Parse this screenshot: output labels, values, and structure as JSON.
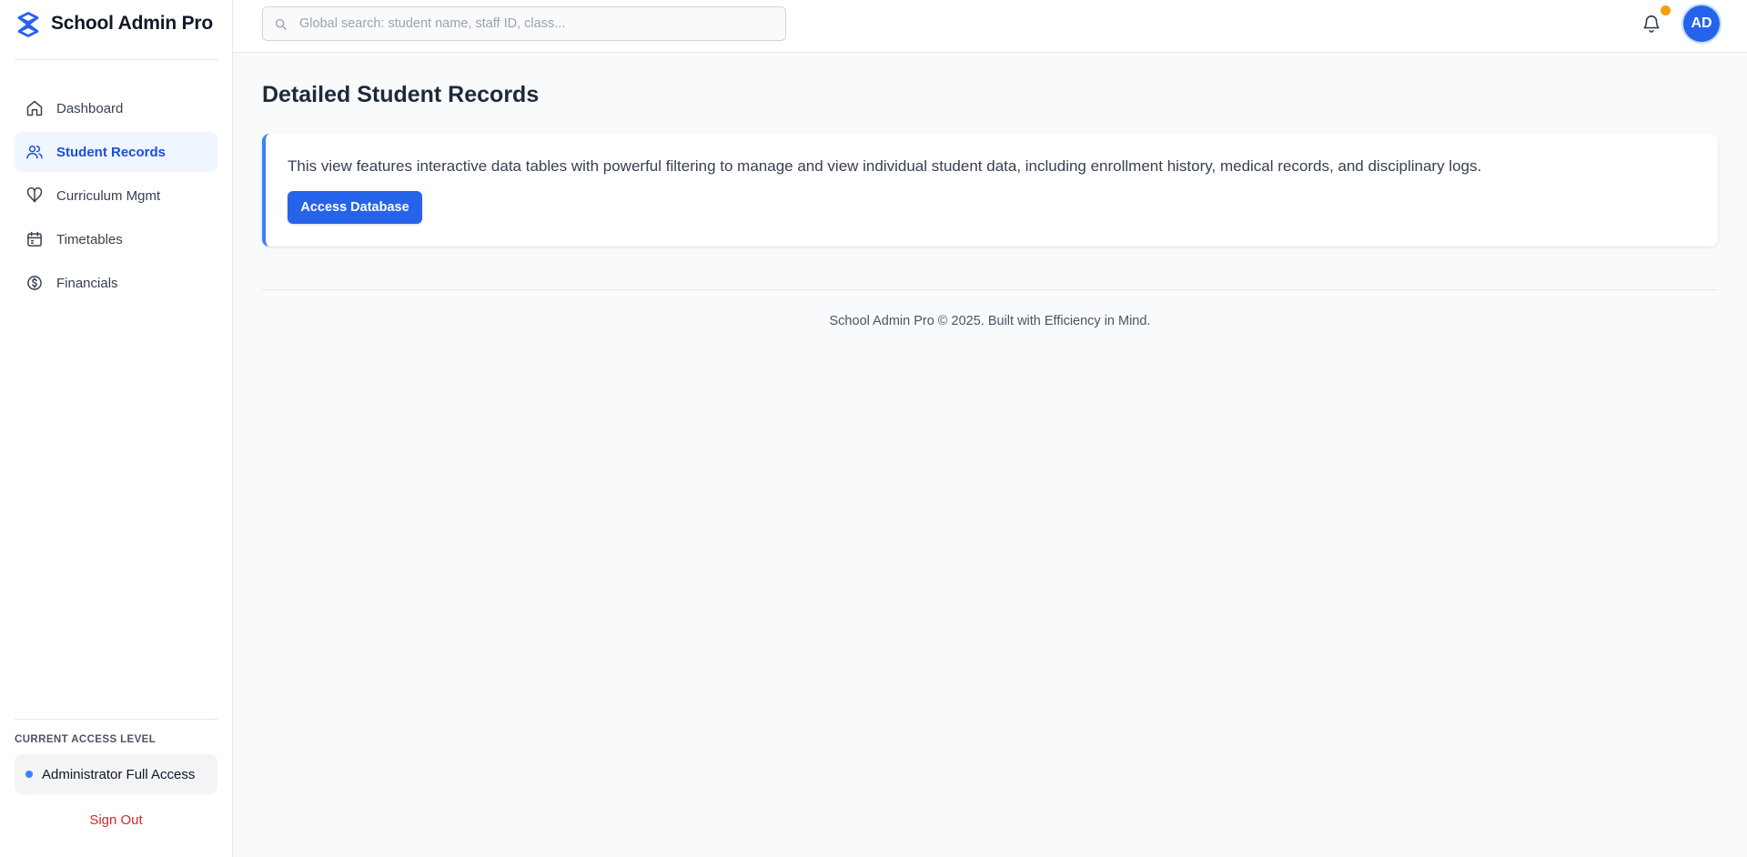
{
  "brand": {
    "name": "School Admin Pro",
    "accent": "#2563eb"
  },
  "sidebar": {
    "items": [
      {
        "label": "Dashboard",
        "icon": "home-icon",
        "active": false
      },
      {
        "label": "Student Records",
        "icon": "users-icon",
        "active": true
      },
      {
        "label": "Curriculum Mgmt",
        "icon": "book-icon",
        "active": false
      },
      {
        "label": "Timetables",
        "icon": "calendar-icon",
        "active": false
      },
      {
        "label": "Financials",
        "icon": "coin-icon",
        "active": false
      }
    ],
    "access": {
      "label": "CURRENT ACCESS LEVEL",
      "value": "Administrator Full Access",
      "status_color": "#3b82f6"
    },
    "signout_label": "Sign Out"
  },
  "header": {
    "search": {
      "placeholder": "Global search: student name, staff ID, class...",
      "value": ""
    },
    "notification_color": "#f59e0b",
    "avatar_initials": "AD"
  },
  "main": {
    "title": "Detailed Student Records",
    "card": {
      "text": "This view features interactive data tables with powerful filtering to manage and view individual student data, including enrollment history, medical records, and disciplinary logs.",
      "button_label": "Access Database"
    }
  },
  "footer": {
    "text": "School Admin Pro © 2025. Built with Efficiency in Mind."
  }
}
